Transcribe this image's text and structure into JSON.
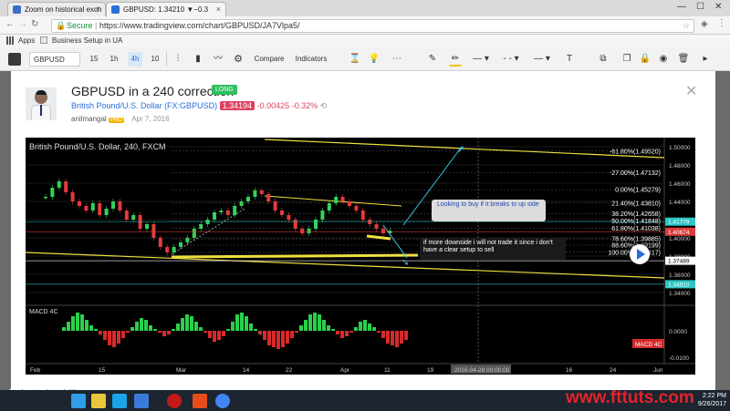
{
  "browser": {
    "tabs": [
      {
        "title": "Zoom on historical exch",
        "active": false
      },
      {
        "title": "GBPUSD: 1.34210 ▼−0.3",
        "active": true
      }
    ],
    "secure_label": "Secure",
    "url": "https://www.tradingview.com/chart/GBPUSD/JA7Vlpa5/",
    "bookmarks": {
      "apps": "Apps",
      "item1": "Business Setup in UA"
    }
  },
  "toolbar": {
    "symbol": "GBPUSD",
    "intervals": [
      "15",
      "1h",
      "4h",
      "10"
    ],
    "compare": "Compare",
    "indicators": "Indicators"
  },
  "idea": {
    "title": "GBPUSD in a 240 correction",
    "badge": "LONG",
    "instrument": "British Pound/U.S. Dollar",
    "exchange_symbol": "(FX:GBPUSD)",
    "price": "1.34194",
    "change": "-0.00425",
    "change_pct": "-0.32%",
    "author": "anilmangal",
    "author_badge": "PRO",
    "date": "Apr 7, 2016"
  },
  "chart_data": {
    "type": "line",
    "title": "British Pound/U.S. Dollar, 240, FXCM",
    "fib_levels": [
      {
        "label": "-61.80%(1.49520)"
      },
      {
        "label": "-27.00%(1.47132)"
      },
      {
        "label": "0.00%(1.45279)"
      },
      {
        "label": "21.40%(1.43810)"
      },
      {
        "label": "38.20%(1.42658)"
      },
      {
        "label": "50.00%(1.41848)"
      },
      {
        "label": "61.80%(1.41038)"
      },
      {
        "label": "78.60%(1.39885)"
      },
      {
        "label": "88.60%(1.39199)"
      },
      {
        "label": "100.00%(1.38417)"
      }
    ],
    "y_ticks": [
      "1.50000",
      "1.48000",
      "1.46000",
      "1.44000",
      "1.42000",
      "1.40000",
      "1.38000",
      "1.36000",
      "1.34000"
    ],
    "ylim": [
      1.33,
      1.505
    ],
    "price_tags": [
      {
        "value": 1.41779,
        "label": "1.41779",
        "color": "#2ec4c4"
      },
      {
        "value": 1.40674,
        "label": "1.40674",
        "color": "#e03a3a"
      },
      {
        "value": 1.37489,
        "label": "1.37489",
        "color": "#ffffff"
      },
      {
        "value": 1.3491,
        "label": "1.34910",
        "color": "#2ec4c4"
      }
    ],
    "x_ticks": [
      "Feb",
      "15",
      "Mar",
      "14",
      "22",
      "Apr",
      "11",
      "19",
      "2016-04-28 00:00:00",
      "16",
      "24",
      "Jun"
    ],
    "annotations": [
      "Looking to buy if it breaks to up side",
      "if more downside i will not trade it since i don't have a clear setup to sell"
    ],
    "macd": {
      "label": "MACD 4C",
      "y_ticks": [
        "0.0000",
        "-0.0100"
      ],
      "tag": "MACD 4C",
      "hist": [
        0.2,
        0.5,
        0.8,
        1.0,
        0.9,
        0.6,
        0.3,
        0.1,
        -0.2,
        -0.5,
        -0.8,
        -0.9,
        -0.7,
        -0.4,
        -0.1,
        0.2,
        0.5,
        0.7,
        0.6,
        0.3,
        0.1,
        -0.1,
        -0.3,
        -0.2,
        0.1,
        0.4,
        0.7,
        0.9,
        0.8,
        0.5,
        0.2,
        -0.1,
        -0.4,
        -0.6,
        -0.5,
        -0.3,
        0.1,
        0.5,
        0.9,
        1.0,
        0.8,
        0.4,
        0.1,
        -0.2,
        -0.5,
        -0.8,
        -0.9,
        -1.0,
        -0.9,
        -0.7,
        -0.4,
        -0.1,
        0.3,
        0.6,
        0.9,
        1.0,
        0.9,
        0.6,
        0.3,
        0.1,
        -0.2,
        -0.4,
        -0.3,
        -0.1,
        0.2,
        0.5,
        0.6,
        0.4,
        0.2,
        -0.1,
        -0.4,
        -0.7,
        -0.8,
        -0.9,
        -0.7,
        -0.5
      ]
    }
  },
  "video": {
    "timestamp": "01:01:15",
    "watermark": "www.fttuts.com"
  },
  "taskbar": {
    "time": "2:22 PM",
    "date": "9/26/2017"
  }
}
